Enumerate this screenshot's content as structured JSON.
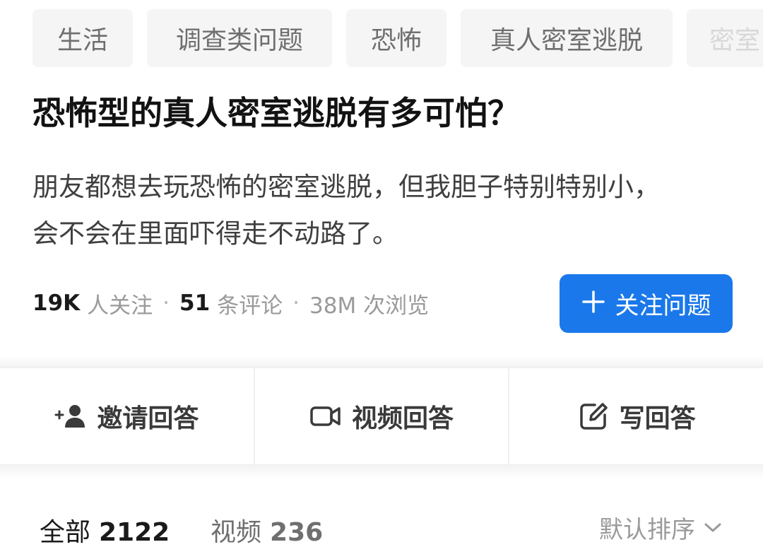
{
  "tags": [
    "生活",
    "调查类问题",
    "恐怖",
    "真人密室逃脱",
    "密室"
  ],
  "question": {
    "title": "恐怖型的真人密室逃脱有多可怕？",
    "description_line1": "朋友都想去玩恐怖的密室逃脱，但我胆子特别特别小，",
    "description_line2": "会不会在里面吓得走不动路了。"
  },
  "stats": {
    "followers_count": "19K",
    "followers_label": "人关注",
    "comments_count": "51",
    "comments_label": "条评论",
    "views": "38M 次浏览",
    "separator": "·"
  },
  "follow_button": {
    "icon": "plus-icon",
    "label": "关注问题",
    "color": "#1a78ea"
  },
  "actions": [
    {
      "icon": "invite-user-icon",
      "label": "邀请回答"
    },
    {
      "icon": "video-camera-icon",
      "label": "视频回答"
    },
    {
      "icon": "edit-icon",
      "label": "写回答"
    }
  ],
  "answer_tabs": [
    {
      "label": "全部",
      "count": "2122",
      "active": true
    },
    {
      "label": "视频",
      "count": "236",
      "active": false
    }
  ],
  "sort": {
    "label": "默认排序",
    "icon": "chevron-down-icon"
  }
}
